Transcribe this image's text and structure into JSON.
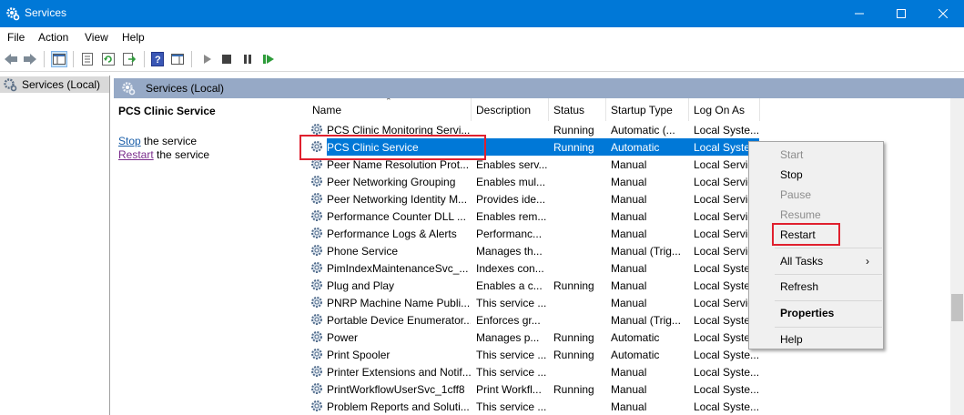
{
  "window": {
    "title": "Services"
  },
  "menu": [
    "File",
    "Action",
    "View",
    "Help"
  ],
  "tree": {
    "root_label": "Services (Local)"
  },
  "pane": {
    "header_label": "Services (Local)"
  },
  "details": {
    "service_name": "PCS Clinic Service",
    "stop_link": "Stop",
    "stop_suffix": " the service",
    "restart_link": "Restart",
    "restart_suffix": " the service"
  },
  "columns": [
    "Name",
    "Description",
    "Status",
    "Startup Type",
    "Log On As"
  ],
  "rows": [
    {
      "name": "PCS Clinic Monitoring Servi...",
      "desc": "",
      "status": "Running",
      "startup": "Automatic (...",
      "logon": "Local Syste..."
    },
    {
      "name": "PCS Clinic Service",
      "desc": "",
      "status": "Running",
      "startup": "Automatic",
      "logon": "Local Syste..."
    },
    {
      "name": "Peer Name Resolution Prot...",
      "desc": "Enables serv...",
      "status": "",
      "startup": "Manual",
      "logon": "Local Service"
    },
    {
      "name": "Peer Networking Grouping",
      "desc": "Enables mul...",
      "status": "",
      "startup": "Manual",
      "logon": "Local Service"
    },
    {
      "name": "Peer Networking Identity M...",
      "desc": "Provides ide...",
      "status": "",
      "startup": "Manual",
      "logon": "Local Service"
    },
    {
      "name": "Performance Counter DLL ...",
      "desc": "Enables rem...",
      "status": "",
      "startup": "Manual",
      "logon": "Local Service"
    },
    {
      "name": "Performance Logs & Alerts",
      "desc": "Performanc...",
      "status": "",
      "startup": "Manual",
      "logon": "Local Service"
    },
    {
      "name": "Phone Service",
      "desc": "Manages th...",
      "status": "",
      "startup": "Manual (Trig...",
      "logon": "Local Service"
    },
    {
      "name": "PimIndexMaintenanceSvc_...",
      "desc": "Indexes con...",
      "status": "",
      "startup": "Manual",
      "logon": "Local Syste..."
    },
    {
      "name": "Plug and Play",
      "desc": "Enables a c...",
      "status": "Running",
      "startup": "Manual",
      "logon": "Local Syste..."
    },
    {
      "name": "PNRP Machine Name Publi...",
      "desc": "This service ...",
      "status": "",
      "startup": "Manual",
      "logon": "Local Service"
    },
    {
      "name": "Portable Device Enumerator...",
      "desc": "Enforces gr...",
      "status": "",
      "startup": "Manual (Trig...",
      "logon": "Local Syste..."
    },
    {
      "name": "Power",
      "desc": "Manages p...",
      "status": "Running",
      "startup": "Automatic",
      "logon": "Local Syste..."
    },
    {
      "name": "Print Spooler",
      "desc": "This service ...",
      "status": "Running",
      "startup": "Automatic",
      "logon": "Local Syste..."
    },
    {
      "name": "Printer Extensions and Notif...",
      "desc": "This service ...",
      "status": "",
      "startup": "Manual",
      "logon": "Local Syste..."
    },
    {
      "name": "PrintWorkflowUserSvc_1cff8",
      "desc": "Print Workfl...",
      "status": "Running",
      "startup": "Manual",
      "logon": "Local Syste..."
    },
    {
      "name": "Problem Reports and Soluti...",
      "desc": "This service ...",
      "status": "",
      "startup": "Manual",
      "logon": "Local Syste..."
    }
  ],
  "context_menu": {
    "start": "Start",
    "stop": "Stop",
    "pause": "Pause",
    "resume": "Resume",
    "restart": "Restart",
    "all_tasks": "All Tasks",
    "refresh": "Refresh",
    "properties": "Properties",
    "help": "Help"
  },
  "colors": {
    "titlebar": "#0078d7",
    "selection": "#0078d7",
    "highlight_box": "#e0202e",
    "pane_header": "#96a9c6"
  }
}
